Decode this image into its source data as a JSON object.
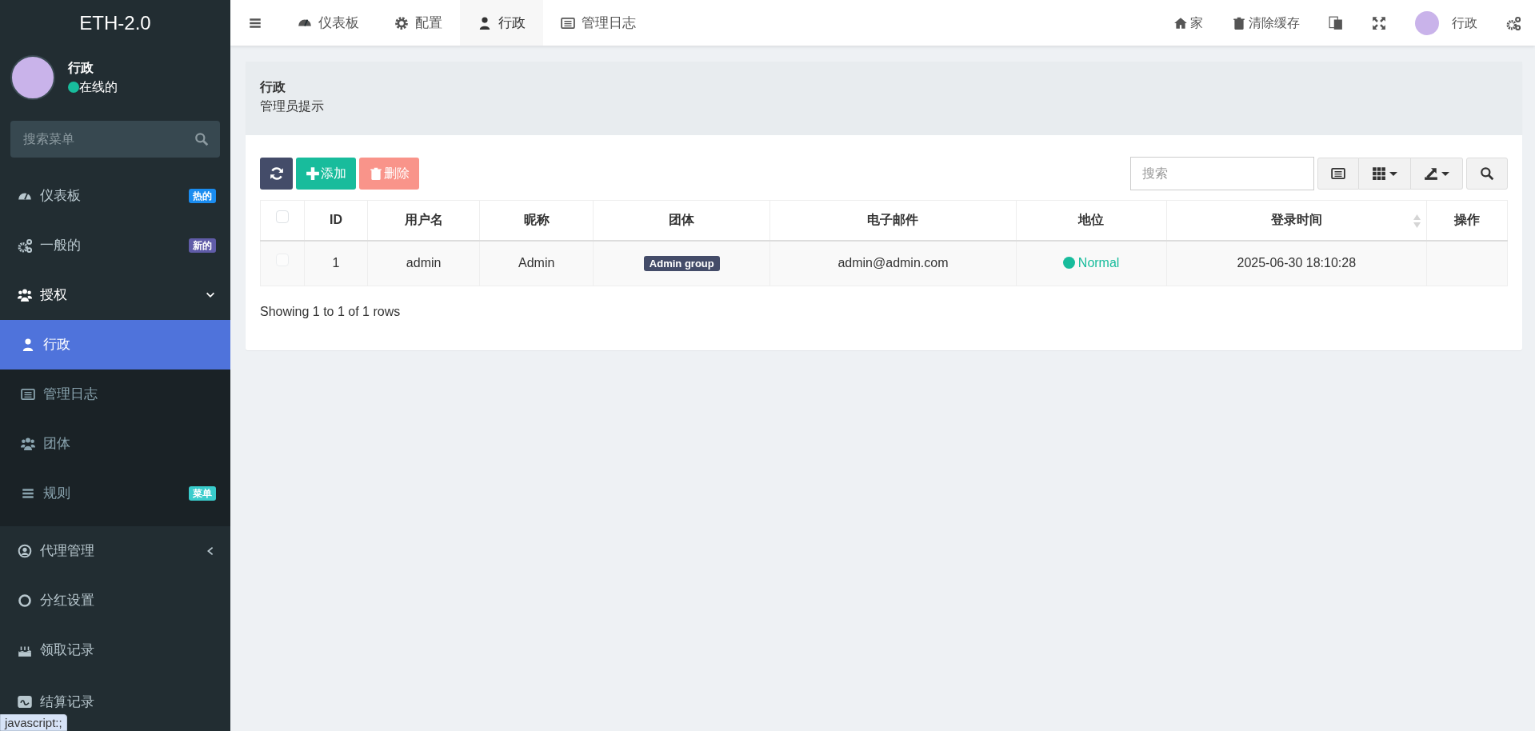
{
  "brand": "ETH-2.0",
  "user_panel": {
    "name": "行政",
    "status": "在线的"
  },
  "sidebar_search": {
    "placeholder": "搜索菜单"
  },
  "sidebar": {
    "items": [
      {
        "label": "仪表板",
        "selected": false,
        "badge": {
          "text": "热的",
          "color": "#1a8cf0"
        }
      },
      {
        "label": "一般的",
        "selected": false,
        "badge": {
          "text": "新的",
          "color": "#605ca8"
        }
      },
      {
        "label": "授权",
        "selected": false,
        "expanded": true,
        "children": [
          {
            "label": "行政",
            "selected": true
          },
          {
            "label": "管理日志",
            "selected": false
          },
          {
            "label": "团体",
            "selected": false
          },
          {
            "label": "规则",
            "selected": false,
            "badge": {
              "text": "菜单",
              "color": "#39cccc"
            }
          }
        ]
      },
      {
        "label": "代理管理",
        "selected": false,
        "expanded": false
      },
      {
        "label": "分红设置",
        "selected": false
      },
      {
        "label": "领取记录",
        "selected": false
      },
      {
        "label": "结算记录",
        "selected": false
      }
    ]
  },
  "tabs": [
    {
      "label": "仪表板",
      "selected": false
    },
    {
      "label": "配置",
      "selected": false
    },
    {
      "label": "行政",
      "selected": true
    },
    {
      "label": "管理日志",
      "selected": false
    }
  ],
  "top_nav": {
    "home": "家",
    "clear_cache": "清除缓存",
    "user": "行政"
  },
  "panel": {
    "title": "行政",
    "subtitle": "管理员提示"
  },
  "toolbar": {
    "add": "添加",
    "delete": {
      "label": "删除",
      "disabled": true
    },
    "search": {
      "placeholder": "搜索"
    }
  },
  "table": {
    "select_all": {
      "checked": false
    },
    "columns": [
      {
        "label": "ID",
        "sortable": false
      },
      {
        "label": "用户名",
        "sortable": false
      },
      {
        "label": "昵称",
        "sortable": false
      },
      {
        "label": "团体",
        "sortable": false
      },
      {
        "label": "电子邮件",
        "sortable": false
      },
      {
        "label": "地位",
        "sortable": false
      },
      {
        "label": "登录时间",
        "sortable": true
      },
      {
        "label": "操作",
        "sortable": false
      }
    ],
    "rows": [
      {
        "checked": false,
        "disabled": true,
        "id": "1",
        "username": "admin",
        "nickname": "Admin",
        "group": "Admin group",
        "email": "admin@admin.com",
        "status": {
          "text": "Normal",
          "color": "#18bc9c"
        },
        "login_time": "2025-06-30 18:10:28"
      }
    ]
  },
  "pagination": {
    "summary": "Showing 1 to 1 of 1 rows"
  },
  "status_bar": "javascript:;"
}
